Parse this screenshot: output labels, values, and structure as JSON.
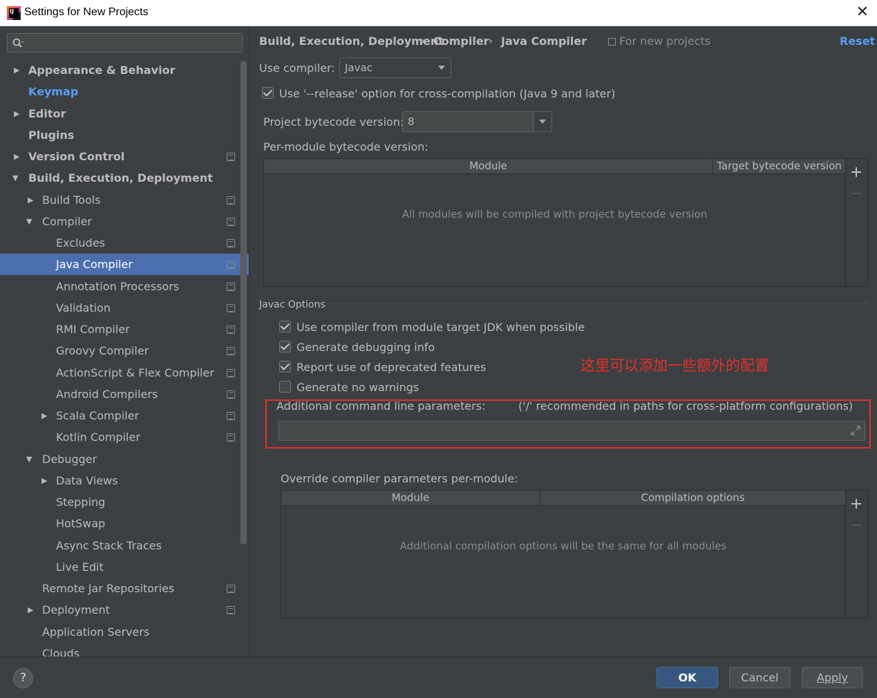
{
  "window": {
    "title": "Settings for New Projects"
  },
  "search": {
    "placeholder": ""
  },
  "sidebar": {
    "items": [
      {
        "label": "Appearance & Behavior"
      },
      {
        "label": "Keymap"
      },
      {
        "label": "Editor"
      },
      {
        "label": "Plugins"
      },
      {
        "label": "Version Control"
      },
      {
        "label": "Build, Execution, Deployment"
      },
      {
        "label": "Build Tools"
      },
      {
        "label": "Compiler"
      },
      {
        "label": "Excludes"
      },
      {
        "label": "Java Compiler"
      },
      {
        "label": "Annotation Processors"
      },
      {
        "label": "Validation"
      },
      {
        "label": "RMI Compiler"
      },
      {
        "label": "Groovy Compiler"
      },
      {
        "label": "ActionScript & Flex Compiler"
      },
      {
        "label": "Android Compilers"
      },
      {
        "label": "Scala Compiler"
      },
      {
        "label": "Kotlin Compiler"
      },
      {
        "label": "Debugger"
      },
      {
        "label": "Data Views"
      },
      {
        "label": "Stepping"
      },
      {
        "label": "HotSwap"
      },
      {
        "label": "Async Stack Traces"
      },
      {
        "label": "Live Edit"
      },
      {
        "label": "Remote Jar Repositories"
      },
      {
        "label": "Deployment"
      },
      {
        "label": "Application Servers"
      },
      {
        "label": "Clouds"
      }
    ]
  },
  "breadcrumb": {
    "items": [
      "Build, Execution, Deployment",
      "Compiler",
      "Java Compiler"
    ],
    "separator": "›",
    "scope": "For new projects",
    "reset": "Reset"
  },
  "compiler": {
    "use_compiler_label": "Use compiler:",
    "use_compiler_value": "Javac",
    "release_option_label": "Use '--release' option for cross-compilation (Java 9 and later)",
    "release_option_checked": true,
    "project_bytecode_label": "Project bytecode version:",
    "project_bytecode_value": "8",
    "per_module_label": "Per-module bytecode version:",
    "per_module_table": {
      "columns": [
        "Module",
        "Target bytecode version"
      ],
      "empty_text": "All modules will be compiled with project bytecode version"
    }
  },
  "javac": {
    "section_title": "Javac Options",
    "options": [
      {
        "label": "Use compiler from module target JDK when possible",
        "checked": true
      },
      {
        "label": "Generate debugging info",
        "checked": true
      },
      {
        "label": "Report use of deprecated features",
        "checked": true
      },
      {
        "label": "Generate no warnings",
        "checked": false
      }
    ],
    "additional_params_label": "Additional command line parameters:",
    "additional_params_hint": "('/' recommended in paths for cross-platform configurations)",
    "additional_params_value": "",
    "override_label": "Override compiler parameters per-module:",
    "override_table": {
      "columns": [
        "Module",
        "Compilation options"
      ],
      "empty_text": "Additional compilation options will be the same for all modules"
    }
  },
  "annotation": {
    "text": "这里可以添加一些额外的配置",
    "color": "#e5312d"
  },
  "buttons": {
    "ok": "OK",
    "cancel": "Cancel",
    "apply": "Apply",
    "help": "?"
  },
  "colors": {
    "selection": "#4b6eaf",
    "link": "#589df6",
    "background": "#3c3f41"
  }
}
